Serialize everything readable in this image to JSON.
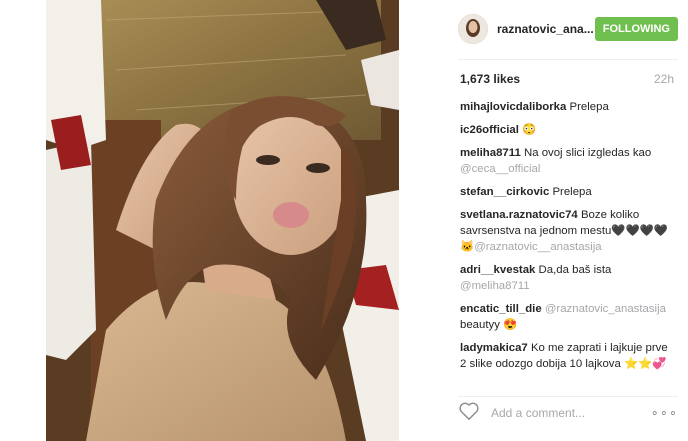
{
  "post": {
    "username": "raznatovic_ana...",
    "follow_label": "FOLLOWING",
    "likes": "1,673 likes",
    "time": "22h",
    "comment_placeholder": "Add a comment...",
    "more_label": "∘∘∘"
  },
  "comments": [
    {
      "user": "mihajlovicdaliborka",
      "parts": [
        {
          "text": "Prelepa"
        }
      ]
    },
    {
      "user": "ic26official",
      "parts": [
        {
          "text": "😳"
        }
      ]
    },
    {
      "user": "meliha8711",
      "parts": [
        {
          "text": "Na ovoj slici izgledas kao "
        },
        {
          "text": "@ceca__official",
          "mention": true
        }
      ]
    },
    {
      "user": "stefan__cirkovic",
      "parts": [
        {
          "text": "Prelepa"
        }
      ]
    },
    {
      "user": "svetlana.raznatovic74",
      "parts": [
        {
          "text": "Boze koliko savrsenstva na jednom mestu🖤🖤🖤🖤 🐱"
        },
        {
          "text": "@raznatovic__anastasija",
          "mention": true
        }
      ]
    },
    {
      "user": "adri__kvestak",
      "parts": [
        {
          "text": "Da,da baš ista "
        },
        {
          "text": "@meliha8711",
          "mention": true
        }
      ]
    },
    {
      "user": "encatic_till_die",
      "parts": [
        {
          "text": "@raznatovic_anastasija",
          "mention": true
        },
        {
          "text": " beautyy 😍"
        }
      ]
    },
    {
      "user": "ladymakica7",
      "parts": [
        {
          "text": "Ko me zaprati i lajkuje prve 2 slike odozgo dobija 10 lajkova ⭐⭐💞"
        }
      ]
    }
  ],
  "colors": {
    "follow_bg": "#70c050",
    "text": "#262626",
    "muted": "#a5a7aa"
  }
}
